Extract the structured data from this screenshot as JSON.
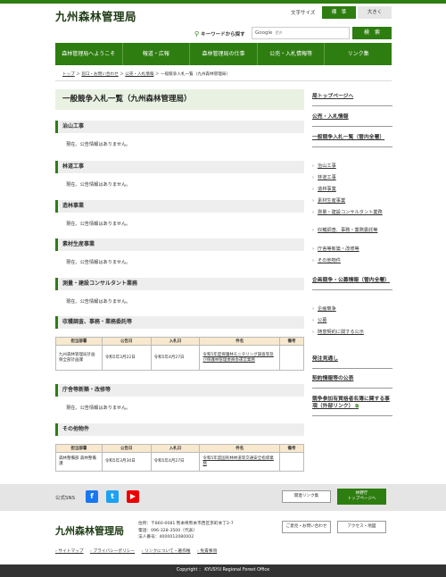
{
  "header": {
    "site_name": "九州森林管理局",
    "fontsize_label": "文字サイズ",
    "fontsize_standard": "標　準",
    "fontsize_large": "大きく"
  },
  "search": {
    "label": "キーワードから探す",
    "placeholder": "Google",
    "powered": "提供",
    "button": "検　索"
  },
  "nav": [
    "森林管理局へようこそ",
    "報道・広報",
    "森林管理局の仕事",
    "公売・入札情報等",
    "リンク集"
  ],
  "breadcrumb": [
    "トップ",
    "＞",
    "窓口・お問い合わせ",
    "＞",
    "公売・入札情報",
    "＞",
    "一般競争入札一覧（九州森林管理局）"
  ],
  "main": {
    "title": "一般競争入札一覧（九州森林管理局）",
    "no_info": "現在、公告情報はありません。",
    "sections": [
      "治山工事",
      "林道工事",
      "造林事業",
      "素材生産事業",
      "測量・建設コンサルタント業務",
      "収穫調査、事務・業務委託等",
      "庁舎等新築・改修等",
      "その他物件"
    ],
    "table_headers": [
      "担当部署",
      "公告日",
      "入札日",
      "件名",
      "備考"
    ],
    "table1": {
      "dept": "九州森林管理局計画保全部計画課",
      "notice": "令和5年3月22日",
      "bid": "令和5年4月27日",
      "subject": "令和5年度保護林モニタリング調査等及び保護林管理委員会運営業務",
      "note": ""
    },
    "table2": {
      "dept": "森林整備部 森林整備課",
      "notice": "令和5年3月30日",
      "bid": "令和5年4月27日",
      "subject": "令和5年度国有林林道等交通安全指導業務",
      "note": ""
    }
  },
  "sidebar": {
    "top": "局トップページへ",
    "bid_info": "公売・入札情報",
    "list": "一般競争入札一覧（管内全署）",
    "items1": [
      "治山工事",
      "林道工事",
      "造林事業",
      "素材生産事業",
      "測量・建設コンサルタント業務",
      "収穫調査、事務・業務委託等",
      "庁舎等新築・改修等",
      "その他物件"
    ],
    "planning": "企画競争・公募情報（管内全署）",
    "items2": [
      "企画競争",
      "公募",
      "随意契約に関する公示"
    ],
    "orders": "発注見通し",
    "contracts": "契約情報等の公表",
    "qualif": "競争参加有資格者名簿に関する事項（外部リンク）"
  },
  "footer": {
    "sns_label": "公式SNS",
    "related_btn": "関連リンク集",
    "top_btn1": "林野庁",
    "top_btn2": "トップページへ",
    "site_name": "九州森林管理局",
    "addr1": "住所：〒860-0081 熊本県熊本市西区京町本丁2-7",
    "addr2": "電話：096-328-3500（代表）",
    "addr3": "法人番号：4000012080002",
    "contact_btn": "ご意見・お問い合わせ",
    "access_btn": "アクセス・地図",
    "links": [
      "サイトマップ",
      "プライバシーポリシー",
      "リンクについて・著作権",
      "免責事項"
    ],
    "copyright": "Copyright ： KYUSYU Regional Forest Office"
  }
}
